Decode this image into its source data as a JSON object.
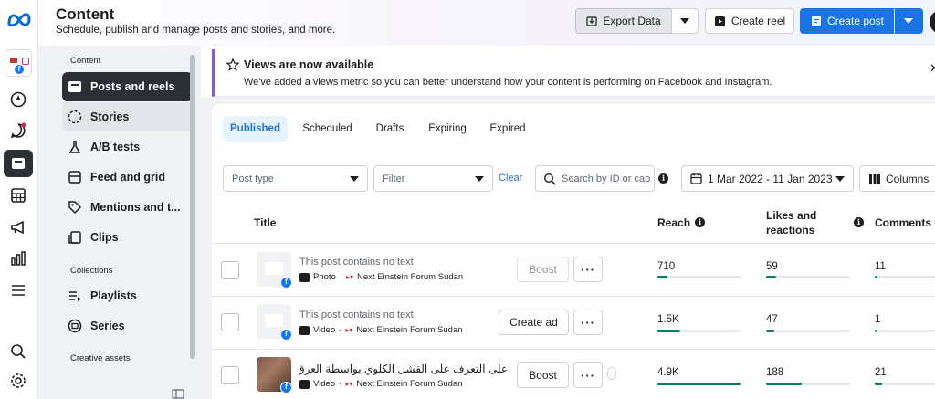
{
  "header": {
    "title": "Content",
    "subtitle": "Schedule, publish and manage posts and stories, and more.",
    "export_label": "Export Data",
    "create_reel_label": "Create reel",
    "create_post_label": "Create post"
  },
  "subnav": {
    "section_content": "Content",
    "section_collections": "Collections",
    "section_creative": "Creative assets",
    "items": [
      {
        "label": "Posts and reels"
      },
      {
        "label": "Stories"
      },
      {
        "label": "A/B tests"
      },
      {
        "label": "Feed and grid"
      },
      {
        "label": "Mentions and t..."
      },
      {
        "label": "Clips"
      }
    ],
    "collections": [
      {
        "label": "Playlists"
      },
      {
        "label": "Series"
      }
    ]
  },
  "banner": {
    "title": "Views are now available",
    "text": "We've added a views metric so you can better understand how your content is performing on Facebook and Instagram."
  },
  "tabs": [
    {
      "label": "Published"
    },
    {
      "label": "Scheduled"
    },
    {
      "label": "Drafts"
    },
    {
      "label": "Expiring"
    },
    {
      "label": "Expired"
    }
  ],
  "filters": {
    "post_type_placeholder": "Post type",
    "filter_placeholder": "Filter",
    "clear_label": "Clear",
    "search_placeholder": "Search by ID or cap",
    "date_range": "1 Mar 2022 - 11 Jan 2023",
    "columns_label": "Columns"
  },
  "table": {
    "headers": {
      "title": "Title",
      "reach": "Reach",
      "likes_line1": "Likes and",
      "likes_line2": "reactions",
      "comments": "Comments"
    },
    "rows": [
      {
        "text": "This post contains no text",
        "type": "Photo",
        "page": "Next Einstein Forum Sudan",
        "action": "Boost",
        "reach": "710",
        "likes": "59",
        "comments": "11"
      },
      {
        "text": "This post contains no text",
        "type": "Video",
        "page": "Next Einstein Forum Sudan",
        "action": "Create ad",
        "reach": "1.5K",
        "likes": "47",
        "comments": "1"
      },
      {
        "text": "على التعرف على الفشل الكلوي بواسطة العرق",
        "type": "Video",
        "page": "Next Einstein Forum Sudan",
        "action": "Boost",
        "reach": "4.9K",
        "likes": "188",
        "comments": "21"
      }
    ]
  },
  "metrics_fill": {
    "reach": [
      0.12,
      0.27,
      0.99
    ],
    "likes": [
      0.12,
      0.1,
      0.42
    ],
    "comments": [
      0.05,
      0.03,
      0.12
    ]
  },
  "colors": {
    "accent": "#1b74e4",
    "bar": "#0a7e5c",
    "banner_border": "#8a5cd0",
    "nav_active": "#2b2f36"
  }
}
